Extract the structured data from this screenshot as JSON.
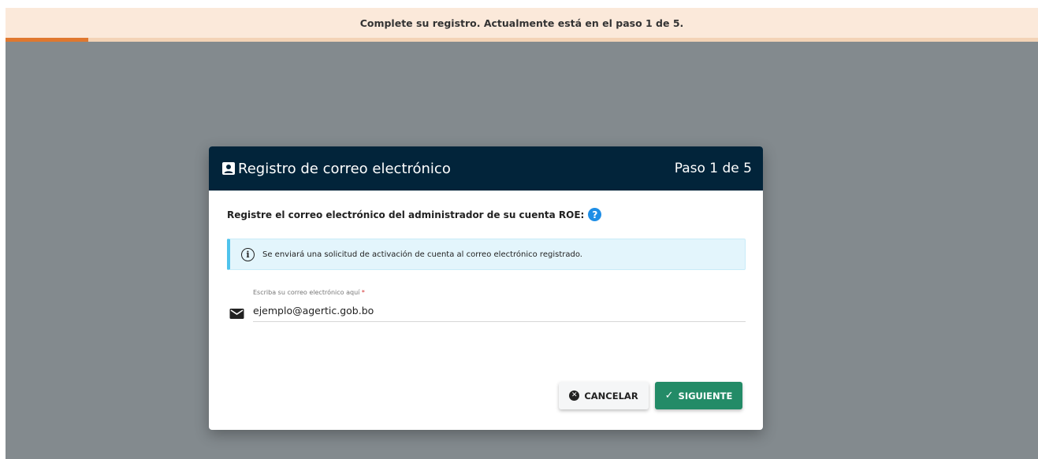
{
  "banner": {
    "text": "Complete su registro. Actualmente está en el paso 1 de 5.",
    "progress_fraction": 0.2,
    "accent_color": "#e0782f"
  },
  "dialog": {
    "title": "Registro de correo electrónico",
    "title_icon": "account-box-icon",
    "step": "Paso 1 de 5",
    "header_color": "#02243a",
    "prompt": "Registre el correo electrónico del administrador de su cuenta ROE:",
    "help_icon": "?",
    "info": {
      "icon": "i",
      "text": "Se enviará una solicitud de activación de cuenta al correo electrónico registrado."
    },
    "email_field": {
      "label": "Escriba su correo electrónico aquí",
      "required_mark": "*",
      "value": "ejemplo@agertic.gob.bo",
      "icon": "mail-icon"
    },
    "buttons": {
      "cancel": {
        "label": "CANCELAR",
        "icon_glyph": "✕"
      },
      "next": {
        "label": "SIGUIENTE",
        "icon_glyph": "✓",
        "color": "#238b67"
      }
    }
  }
}
